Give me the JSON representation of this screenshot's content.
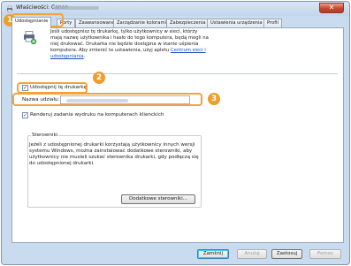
{
  "window": {
    "title": "Właściwości: Canon",
    "close_label": "✕"
  },
  "tabs": [
    {
      "label": "Udostępnianie",
      "active": true
    },
    {
      "label": "Porty"
    },
    {
      "label": "Zaawansowane"
    },
    {
      "label": "Zarządzanie kolorami"
    },
    {
      "label": "Zabezpieczenia"
    },
    {
      "label": "Ustawienia urządzenia"
    },
    {
      "label": "Profil"
    }
  ],
  "sharing": {
    "info_text": "Jeśli udostępnisz tę drukarkę, tylko użytkownicy w sieci, którzy mają nazwę użytkownika i hasło do tego komputera, będą mogli na niej drukować. Drukarka nie będzie dostępna w stanie uśpienia komputera. Aby zmienić te ustawienia, użyj apletu ",
    "link_text": "Centrum sieci i udostępniania",
    "info_end": ".",
    "share_checkbox_label": "Udostępnij tę drukarkę",
    "share_checked": true,
    "share_name_label": "Nazwa udziału:",
    "render_checkbox_label": "Renderuj zadania wydruku na komputerach klienckich",
    "render_checked": true
  },
  "drivers": {
    "legend": "Sterowniki",
    "text": "Jeżeli z udostępnionej drukarki korzystają użytkownicy innych wersji systemu Windows, można zainstalować dodatkowe sterowniki, aby użytkownicy nie musieli szukać sterownika drukarki, gdy podłączą się do udostępnionej drukarki.",
    "button_label": "Dodatkowe sterowniki..."
  },
  "callouts": [
    "1",
    "2",
    "3"
  ],
  "footer": {
    "ok_label": "Zamknij",
    "cancel_label": "Anuluj",
    "apply_label": "Zastosuj",
    "help_label": "Pomoc"
  },
  "colors": {
    "callout": "#ee9d2e",
    "window_frame": "#c9dbee",
    "link": "#1a4fc0"
  },
  "icons": [
    "printer-icon",
    "network-share-icon",
    "close-icon",
    "checkmark-icon"
  ]
}
